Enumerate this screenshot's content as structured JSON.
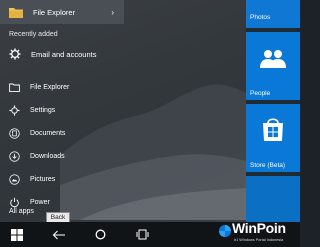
{
  "start_menu": {
    "top_item": {
      "label": "File Explorer",
      "icon": "folder-icon"
    },
    "recently_added": {
      "heading": "Recently added",
      "items": [
        {
          "label": "Email and accounts",
          "icon": "gear-icon"
        }
      ]
    },
    "nav": [
      {
        "label": "File Explorer",
        "icon": "folder-icon"
      },
      {
        "label": "Settings",
        "icon": "gear-icon"
      },
      {
        "label": "Documents",
        "icon": "documents-icon"
      },
      {
        "label": "Downloads",
        "icon": "downloads-icon"
      },
      {
        "label": "Pictures",
        "icon": "pictures-icon"
      },
      {
        "label": "Power",
        "icon": "power-icon"
      }
    ],
    "all_apps_label": "All apps",
    "tooltip": "Back"
  },
  "tiles": [
    {
      "label": "Photos"
    },
    {
      "label": "People",
      "icon": "people-icon"
    },
    {
      "label": "Store (Beta)",
      "icon": "store-icon"
    }
  ],
  "taskbar": {
    "buttons": [
      "start-icon",
      "back-icon",
      "search-icon",
      "task-view-icon"
    ]
  },
  "watermark": {
    "brand": "WinPoin",
    "tagline": "#1 Windows Portal Indonesia"
  },
  "colors": {
    "tile_blue": "#0a78d7",
    "taskbar": "#111417",
    "menu_bg": "#33383d"
  }
}
